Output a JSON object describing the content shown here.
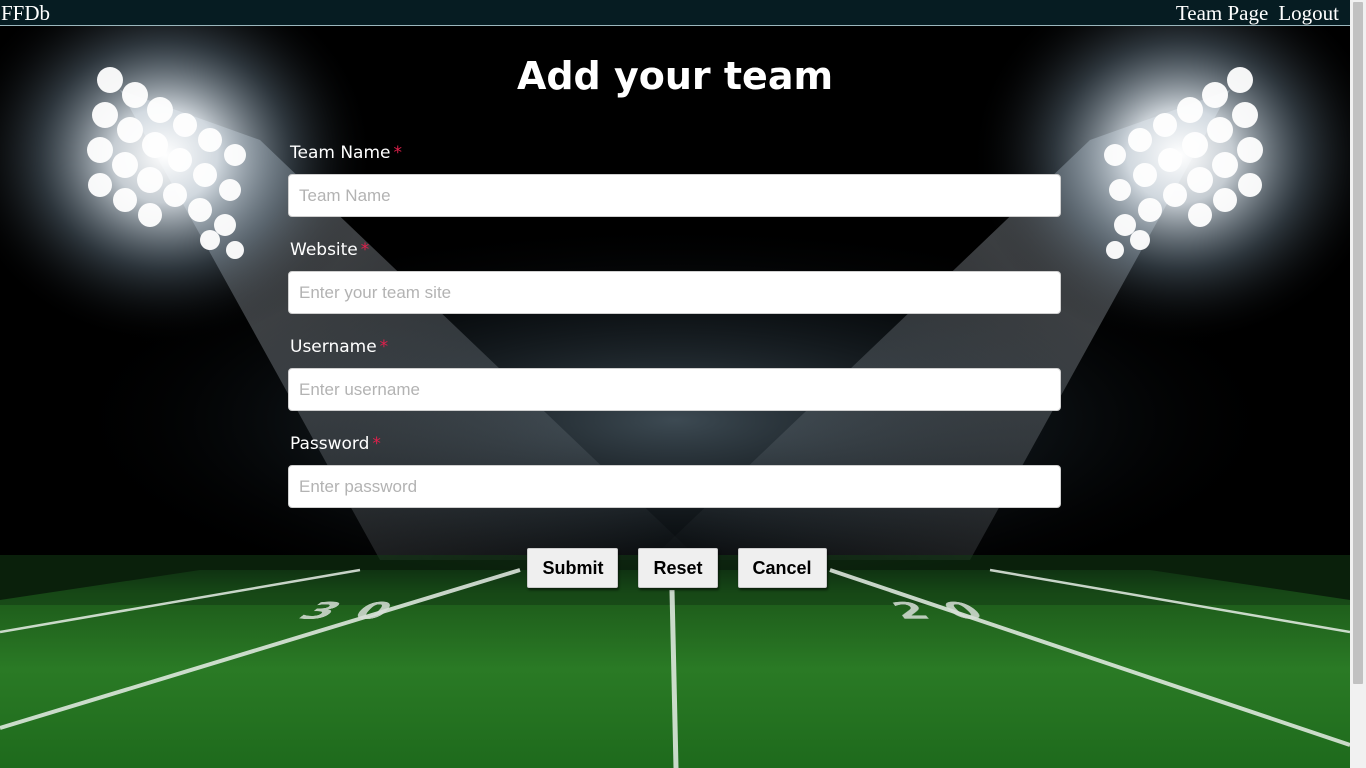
{
  "app": {
    "brand": "FFDb"
  },
  "nav": {
    "team_page": "Team Page",
    "logout": "Logout"
  },
  "form": {
    "title": "Add your team",
    "required_mark": "*",
    "fields": [
      {
        "label": "Team Name",
        "placeholder": "Team Name",
        "value": ""
      },
      {
        "label": "Website",
        "placeholder": "Enter your team site",
        "value": ""
      },
      {
        "label": "Username",
        "placeholder": "Enter username",
        "value": ""
      },
      {
        "label": "Password",
        "placeholder": "Enter password",
        "value": ""
      }
    ],
    "buttons": {
      "submit": "Submit",
      "reset": "Reset",
      "cancel": "Cancel"
    }
  },
  "background": {
    "yard_numbers": [
      "30",
      "20"
    ],
    "colors": {
      "sky": "#000000",
      "turf": "#2e7d25",
      "navbar": "#061c22",
      "required": "#e0204c"
    }
  }
}
